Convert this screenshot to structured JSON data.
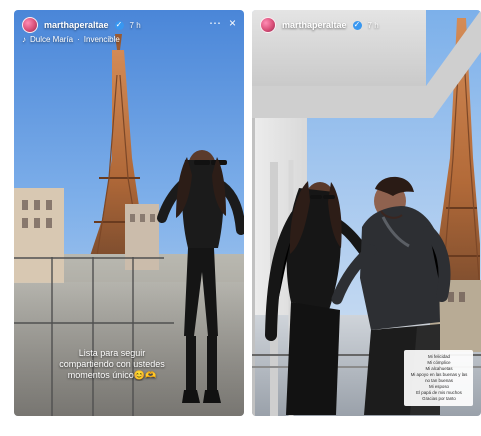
{
  "stories": {
    "left": {
      "username": "marthaperaltae",
      "time": "7 h",
      "music_title": "Dulce María",
      "music_separator": "·",
      "music_artist": "Invencible",
      "caption_lines": [
        "Lista para seguir",
        "compartiendo con ustedes",
        "momentos único😊🫶"
      ]
    },
    "right": {
      "username": "marthaperaltae",
      "time": "7 h",
      "caption_lines": [
        "Mi felicidad",
        "Mi cómplice",
        "Mi alcahuetas",
        "Mi apoyo en las buenas y las",
        "no tan buenas",
        "Mi esposo",
        "El papá de mis muchos",
        "Gracias por tanto"
      ]
    }
  },
  "icons": {
    "more": "⋯",
    "close": "×",
    "music": "♪",
    "verified": "✓"
  },
  "colors": {
    "accent": "#3897f0",
    "tower": "#b3652f",
    "dress": "#181818",
    "jacket": "#2d2f33"
  }
}
